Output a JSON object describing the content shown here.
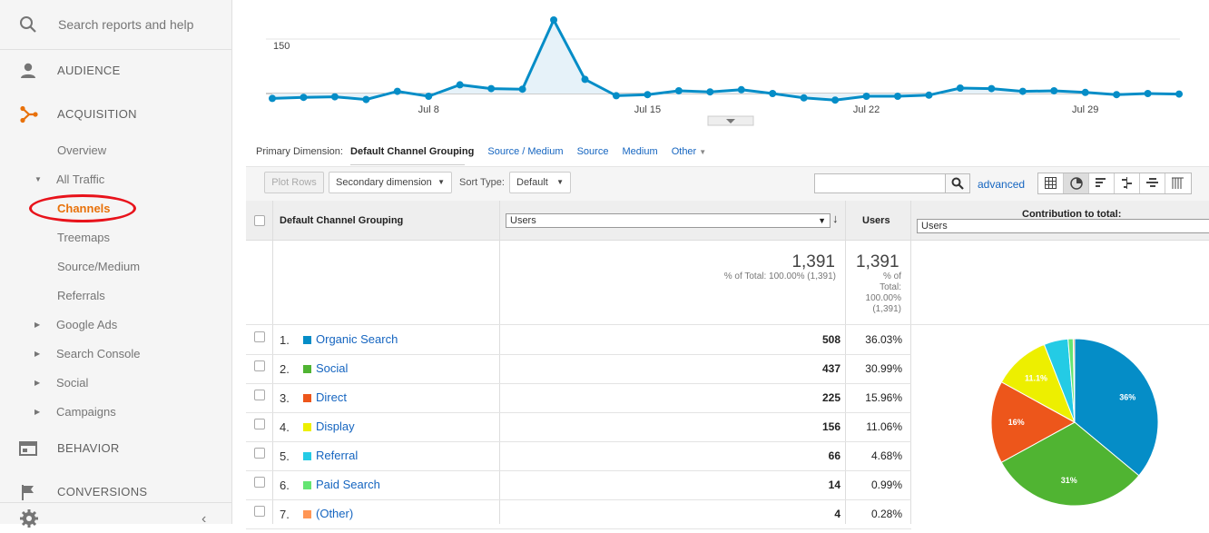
{
  "sidebar": {
    "search_placeholder": "Search reports and help",
    "sections": {
      "audience": "AUDIENCE",
      "acquisition": "ACQUISITION",
      "behavior": "BEHAVIOR",
      "conversions": "CONVERSIONS"
    },
    "items": {
      "overview": "Overview",
      "all_traffic": "All Traffic",
      "channels": "Channels",
      "treemaps": "Treemaps",
      "source_medium": "Source/Medium",
      "referrals": "Referrals",
      "google_ads": "Google Ads",
      "search_console": "Search Console",
      "social": "Social",
      "campaigns": "Campaigns"
    },
    "active_color": "#e8710a",
    "highlight_circle_color": "#e8131b"
  },
  "chart_data": {
    "type": "line",
    "y_tick_label": "150",
    "x_tick_labels": [
      "Jul 8",
      "Jul 15",
      "Jul 22",
      "Jul 29"
    ],
    "values": [
      41,
      43,
      44,
      39,
      54,
      45,
      66,
      59,
      58,
      185,
      76,
      46,
      48,
      55,
      53,
      57,
      50,
      42,
      38,
      45,
      45,
      47,
      60,
      59,
      54,
      55,
      52,
      48,
      50,
      49
    ],
    "line_color": "#058dc7",
    "fill_color": "#e6f2f9"
  },
  "primary_dimension": {
    "label": "Primary Dimension:",
    "current": "Default Channel Grouping",
    "options": [
      "Source / Medium",
      "Source",
      "Medium"
    ],
    "other": "Other"
  },
  "toolbar": {
    "plot_rows": "Plot Rows",
    "secondary_dimension": "Secondary dimension",
    "sort_type_label": "Sort Type:",
    "sort_type_value": "Default",
    "advanced": "advanced"
  },
  "table": {
    "header_dimension": "Default Channel Grouping",
    "metric_select": "Users",
    "header_users": "Users",
    "header_contribution": "Contribution to total:",
    "contribution_select": "Users",
    "totals": {
      "value": "1,391",
      "subtext": "% of Total: 100.00% (1,391)",
      "value2": "1,391",
      "subtext2": "% of Total: 100.00% (1,391)"
    },
    "rows": [
      {
        "num": "1.",
        "name": "Organic Search",
        "color": "#058dc7",
        "users": "508",
        "pct": "36.03%"
      },
      {
        "num": "2.",
        "name": "Social",
        "color": "#50b432",
        "users": "437",
        "pct": "30.99%"
      },
      {
        "num": "3.",
        "name": "Direct",
        "color": "#ed561b",
        "users": "225",
        "pct": "15.96%"
      },
      {
        "num": "4.",
        "name": "Display",
        "color": "#edef00",
        "users": "156",
        "pct": "11.06%"
      },
      {
        "num": "5.",
        "name": "Referral",
        "color": "#24cbe5",
        "users": "66",
        "pct": "4.68%"
      },
      {
        "num": "6.",
        "name": "Paid Search",
        "color": "#64e572",
        "users": "14",
        "pct": "0.99%"
      },
      {
        "num": "7.",
        "name": "(Other)",
        "color": "#ff9655",
        "users": "4",
        "pct": "0.28%"
      }
    ]
  },
  "pie": {
    "slices": [
      {
        "value": 36.03,
        "color": "#058dc7",
        "label": "36%"
      },
      {
        "value": 30.99,
        "color": "#50b432",
        "label": "31%"
      },
      {
        "value": 15.96,
        "color": "#ed561b",
        "label": "16%"
      },
      {
        "value": 11.06,
        "color": "#edef00",
        "label": "11.1%"
      },
      {
        "value": 4.68,
        "color": "#24cbe5",
        "label": ""
      },
      {
        "value": 0.99,
        "color": "#64e572",
        "label": ""
      },
      {
        "value": 0.28,
        "color": "#ff9655",
        "label": ""
      }
    ]
  }
}
